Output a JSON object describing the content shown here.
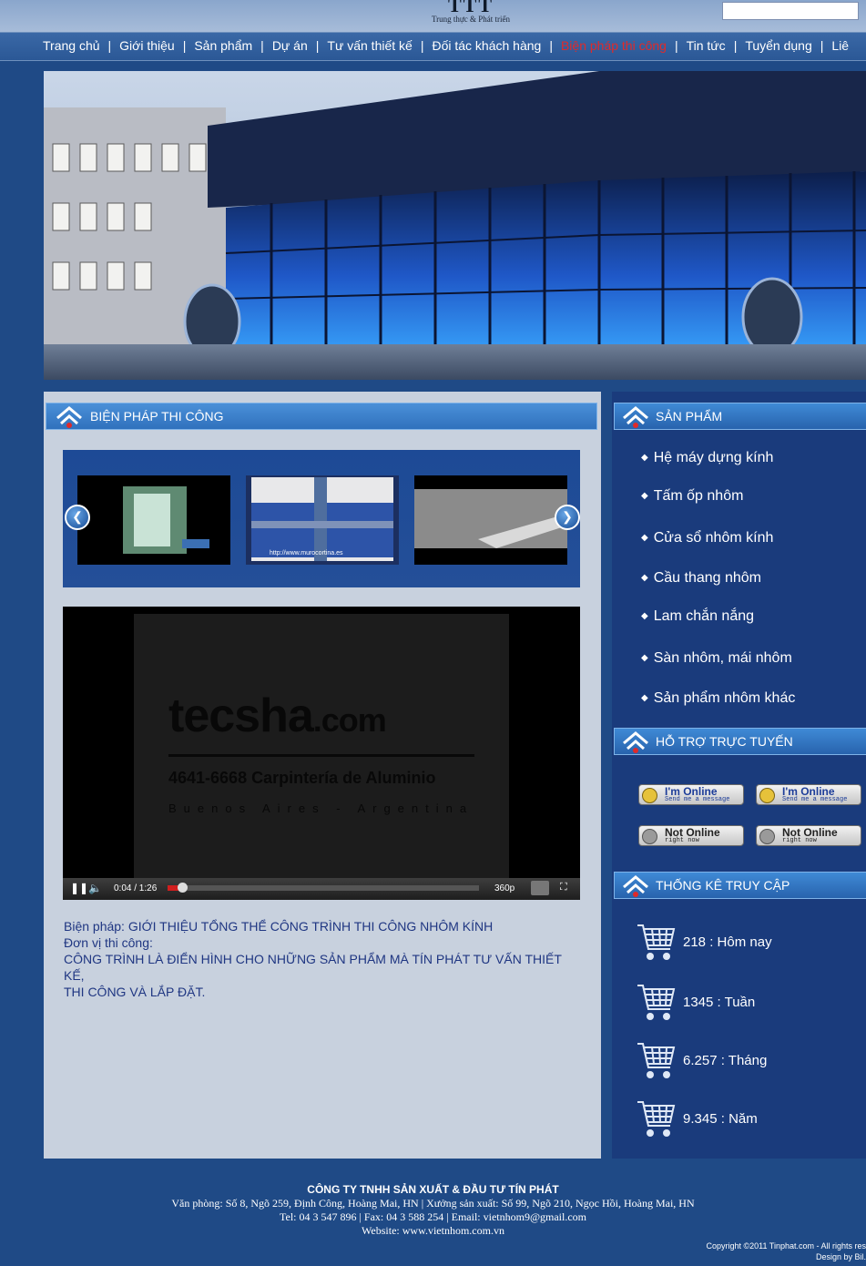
{
  "header": {
    "logo_mark": "TTT",
    "logo_tagline": "Trung thực & Phát triển",
    "search_placeholder": ""
  },
  "nav": {
    "items": [
      {
        "label": "Trang chủ",
        "active": false
      },
      {
        "label": "Giới thiệu",
        "active": false
      },
      {
        "label": "Sản phẩm",
        "active": false
      },
      {
        "label": "Dự án",
        "active": false
      },
      {
        "label": "Tư vấn thiết kế",
        "active": false
      },
      {
        "label": "Đối tác khách hàng",
        "active": false
      },
      {
        "label": "Biện pháp thi công",
        "active": true
      },
      {
        "label": "Tin tức",
        "active": false
      },
      {
        "label": "Tuyển dụng",
        "active": false
      },
      {
        "label": "Liê",
        "active": false
      }
    ],
    "separator": "|"
  },
  "main": {
    "title": "BIỆN PHÁP THI CÔNG",
    "gallery": {
      "prev_icon": "chevron-left-icon",
      "next_icon": "chevron-right-icon",
      "thumb2_caption": "http://www.murocortina.es"
    },
    "video": {
      "brand": "tecsha",
      "brand_domain": ".com",
      "phone": "4641-6668",
      "subtitle": "Carpintería de Aluminio",
      "city": "Buenos Aires - Argentina",
      "time": "0:04 / 1:26",
      "quality": "360p",
      "progress_fraction": 0.047
    },
    "description": {
      "line1": "Biện pháp: GIỚI THIỆU TỔNG THỂ CÔNG TRÌNH THI CÔNG NHÔM KÍNH",
      "line2": "Đơn vị thi công:",
      "line3": "CÔNG TRÌNH LÀ ĐIỂN HÌNH CHO NHỮNG SẢN PHẨM MÀ TÍN PHÁT TƯ VẤN THIẾT KẾ,",
      "line4": "THI CÔNG VÀ LẮP ĐẶT."
    }
  },
  "sidebar": {
    "products_title": "SẢN PHẨM",
    "products": [
      "Hệ máy dựng kính",
      "Tấm ốp nhôm",
      "Cửa sổ nhôm kính",
      "Cầu thang nhôm",
      "Lam chắn nắng",
      "Sàn nhôm, mái nhôm",
      "Sản phẩm nhôm khác"
    ],
    "support_title": "HỖ TRỢ TRỰC TUYẾN",
    "support": {
      "online_title": "I'm Online",
      "online_sub": "Send me a message",
      "offline_title": "Not Online",
      "offline_sub": "right now"
    },
    "stats_title": "THỐNG KÊ TRUY CẬP",
    "stats": [
      {
        "value": "218",
        "label": "Hôm nay"
      },
      {
        "value": "1345",
        "label": "Tuần"
      },
      {
        "value": "6.257",
        "label": "Tháng"
      },
      {
        "value": "9.345",
        "label": "Năm"
      }
    ]
  },
  "footer": {
    "company": "CÔNG TY TNHH SẢN XUẤT & ĐẦU TƯ TÍN PHÁT",
    "address": "Văn phòng: Số 8, Ngõ 259, Định Công, Hoàng Mai, HN | Xưởng sản xuất: Số 99, Ngõ 210, Ngọc Hồi, Hoàng Mai, HN",
    "contact": "Tel: 04 3 547 896 | Fax: 04 3 588 254 | Email: vietnhom9@gmail.com",
    "website": "Website: www.vietnhom.com.vn",
    "copyright": "Copyright ©2011 Tinphat.com - All rights res",
    "design": "Design by Bil."
  },
  "colors": {
    "page_bg": "#1f4a86",
    "nav_active": "#e02a2a",
    "description_text": "#1f3682",
    "sidebar_bg": "#1a3b7c"
  }
}
